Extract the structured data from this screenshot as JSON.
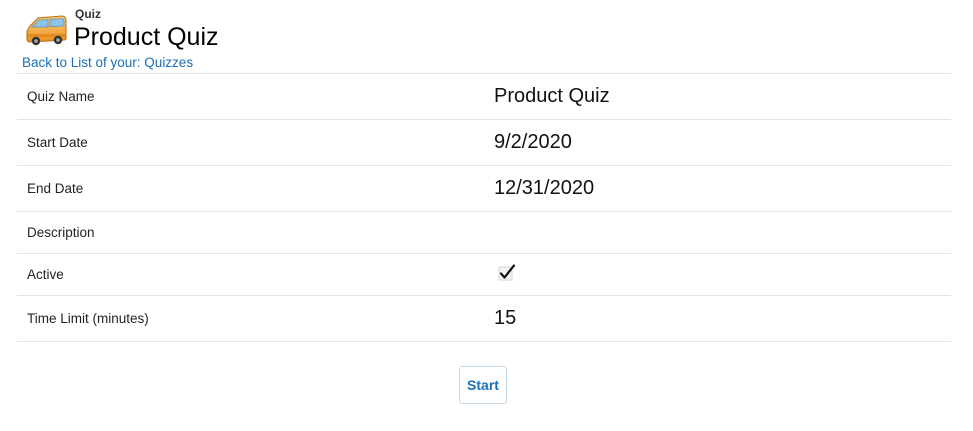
{
  "header": {
    "icon": "van-icon",
    "object_type": "Quiz",
    "title": "Product Quiz",
    "back_link": "Back to List of your: Quizzes"
  },
  "fields": [
    {
      "label": "Quiz Name",
      "value": "Product Quiz"
    },
    {
      "label": "Start Date",
      "value": "9/2/2020"
    },
    {
      "label": "End Date",
      "value": "12/31/2020"
    },
    {
      "label": "Description",
      "value": ""
    },
    {
      "label": "Active",
      "value": true,
      "display": "checked-checkbox-icon"
    },
    {
      "label": "Time Limit (minutes)",
      "value": "15"
    }
  ],
  "actions": {
    "start_label": "Start"
  },
  "colors": {
    "link": "#1a6fb8",
    "divider": "#e3e3e3",
    "button_border": "#c8d9e8"
  }
}
